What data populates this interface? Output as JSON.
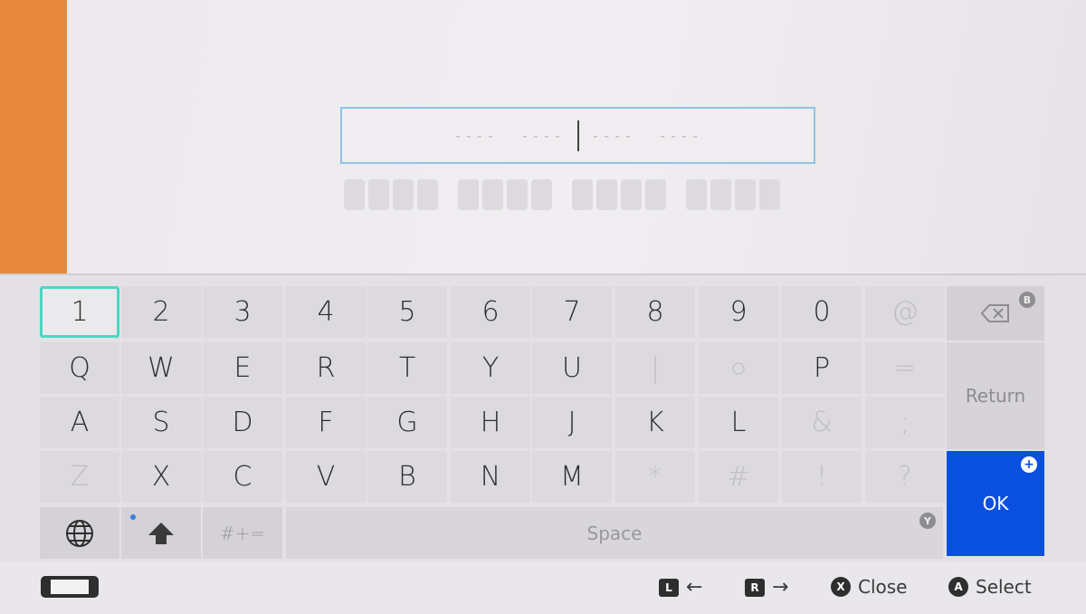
{
  "input": {
    "groups": [
      "----",
      "----",
      "----",
      "----"
    ]
  },
  "keyboard": {
    "rows": [
      [
        {
          "label": "1"
        },
        {
          "label": "2"
        },
        {
          "label": "3"
        },
        {
          "label": "4"
        },
        {
          "label": "5"
        },
        {
          "label": "6"
        },
        {
          "label": "7"
        },
        {
          "label": "8"
        },
        {
          "label": "9"
        },
        {
          "label": "0"
        },
        {
          "label": "@",
          "disabled": true
        }
      ],
      [
        {
          "label": "Q"
        },
        {
          "label": "W"
        },
        {
          "label": "E"
        },
        {
          "label": "R"
        },
        {
          "label": "T"
        },
        {
          "label": "Y"
        },
        {
          "label": "U"
        },
        {
          "label": "|",
          "disabled": true
        },
        {
          "label": "○",
          "disabled": true
        },
        {
          "label": "P"
        },
        {
          "label": "=",
          "disabled": true
        }
      ],
      [
        {
          "label": "A"
        },
        {
          "label": "S"
        },
        {
          "label": "D"
        },
        {
          "label": "F"
        },
        {
          "label": "G"
        },
        {
          "label": "H"
        },
        {
          "label": "J"
        },
        {
          "label": "K"
        },
        {
          "label": "L"
        },
        {
          "label": "&",
          "disabled": true
        },
        {
          "label": ";",
          "disabled": true
        }
      ],
      [
        {
          "label": "Z",
          "disabled": true
        },
        {
          "label": "X"
        },
        {
          "label": "C"
        },
        {
          "label": "V"
        },
        {
          "label": "B"
        },
        {
          "label": "N"
        },
        {
          "label": "M"
        },
        {
          "label": "*",
          "disabled": true
        },
        {
          "label": "#",
          "disabled": true
        },
        {
          "label": "!",
          "disabled": true
        },
        {
          "label": "?",
          "disabled": true
        }
      ]
    ],
    "selected_key": "1",
    "backspace_badge": "B",
    "return_label": "Return",
    "ok_label": "OK",
    "ok_badge": "+",
    "symbols_label": "#+=",
    "space_label": "Space",
    "space_badge": "Y",
    "globe_icon": "globe-icon",
    "shift_icon": "shift-arrow-icon",
    "ok_color": "#0a50e0",
    "selection_color": "#4bd7c4",
    "accent_left_color": "#e8883c"
  },
  "footer": {
    "l_label": "L",
    "l_arrow": "←",
    "r_label": "R",
    "r_arrow": "→",
    "close_button": "X",
    "close_label": "Close",
    "select_button": "A",
    "select_label": "Select",
    "console_icon": "handheld-console-icon"
  }
}
